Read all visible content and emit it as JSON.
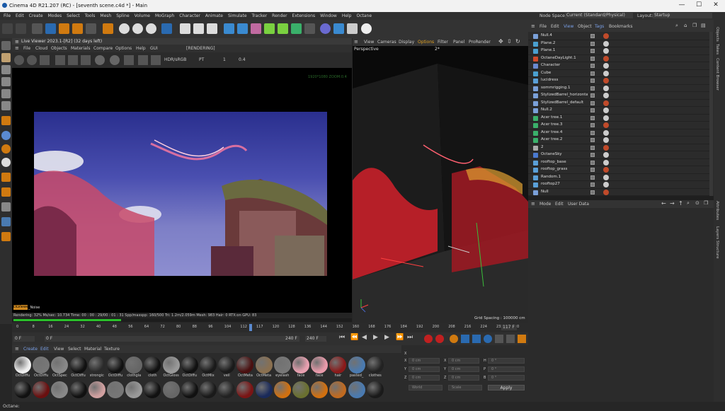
{
  "window": {
    "title": "Cinema 4D R21.207 (RC) - [seventh scene.c4d *] - Main",
    "min": "—",
    "max": "☐",
    "close": "✕"
  },
  "menubar": {
    "items": [
      "File",
      "Edit",
      "Create",
      "Modes",
      "Select",
      "Tools",
      "Mesh",
      "Spline",
      "Volume",
      "MoGraph",
      "Character",
      "Animate",
      "Simulate",
      "Tracker",
      "Render",
      "Extensions",
      "Window",
      "Help",
      "Octane"
    ],
    "node_space_label": "Node Space:",
    "node_space_value": "Current (Standard/Physical)",
    "layout_label": "Layout:",
    "layout_value": "Startup"
  },
  "live_viewer": {
    "title": "Live Viewer 2023.1-[R2] (32 days left)",
    "menu": [
      "File",
      "Cloud",
      "Objects",
      "Materials",
      "Compare",
      "Options",
      "Help",
      "GUI"
    ],
    "rendering_tag": "[RENDERING]",
    "tonemap": "HDR/sRGB",
    "pt": "PT",
    "spp": "1",
    "zoom": "0.4",
    "corner_info": "1920*1080 ZOOM:0.4",
    "kernel_tag": "DLViewer",
    "kernel_mode": "_Noise",
    "status": "Rendering: 32%   Ms/sec: 10.734   Time: 00 : 00 : 29/00 : 01 : 31   Spp/maxspp: 160/500   Tri: 1.2m/2.059m   Mesh: 983   Hair: 0   RTX:on   GPU:    83",
    "progress": 0.32
  },
  "viewport": {
    "menu": [
      "View",
      "Cameras",
      "Display",
      "Options",
      "Filter",
      "Panel",
      "ProRender"
    ],
    "camera": "Perspective",
    "fps": "2*",
    "grid": "Grid Spacing : 100000 cm"
  },
  "object_manager": {
    "menu": [
      "File",
      "Edit",
      "View",
      "Object",
      "Tags",
      "Bookmarks"
    ],
    "objects": [
      {
        "name": "Null.4",
        "icon": "null",
        "color": "#7aa0d8"
      },
      {
        "name": "Plane.2",
        "icon": "plane",
        "color": "#4aa0d0"
      },
      {
        "name": "Plane.1",
        "icon": "plane",
        "color": "#4aa0d0"
      },
      {
        "name": "OctaneDayLight.1",
        "icon": "light",
        "color": "#d04a2a"
      },
      {
        "name": "Character",
        "icon": "character",
        "color": "#6a8ad0"
      },
      {
        "name": "Cube",
        "icon": "cube",
        "color": "#4aa0d0"
      },
      {
        "name": "lucidress",
        "icon": "mesh",
        "color": "#5aa0d8"
      },
      {
        "name": "sommrigging.1",
        "icon": "null",
        "color": "#7aa0d8"
      },
      {
        "name": "StylizedBarrel_horizontal",
        "icon": "null",
        "color": "#7aa0d8"
      },
      {
        "name": "StylizedBarrel_default",
        "icon": "null",
        "color": "#7aa0d8"
      },
      {
        "name": "Null.2",
        "icon": "null",
        "color": "#7aa0d8"
      },
      {
        "name": "Acer tree.1",
        "icon": "tree",
        "color": "#3ab06a"
      },
      {
        "name": "Acer tree.3",
        "icon": "tree",
        "color": "#3ab06a"
      },
      {
        "name": "Acer tree.4",
        "icon": "tree",
        "color": "#3ab06a"
      },
      {
        "name": "Acer tree.2",
        "icon": "tree",
        "color": "#3ab06a"
      },
      {
        "name": "2",
        "icon": "null",
        "color": "#aaaaaa"
      },
      {
        "name": "OctaneSky",
        "icon": "sky",
        "color": "#4a7ad0"
      },
      {
        "name": "rooftop_base",
        "icon": "mesh",
        "color": "#5aa0d8"
      },
      {
        "name": "rooftop_grass",
        "icon": "mesh",
        "color": "#5aa0d8"
      },
      {
        "name": "Random.1",
        "icon": "mograph",
        "color": "#5aa0d8"
      },
      {
        "name": "rooftop27",
        "icon": "mesh",
        "color": "#5aa0d8"
      },
      {
        "name": "Null",
        "icon": "null",
        "color": "#7aa0d8"
      }
    ]
  },
  "attributes": {
    "menu": [
      "Mode",
      "Edit",
      "User Data"
    ]
  },
  "right_tabs": [
    "Objects",
    "Takes",
    "Content Browser",
    "Attributes",
    "Layers",
    "Structure"
  ],
  "timeline": {
    "ticks": [
      "0",
      "8",
      "16",
      "24",
      "32",
      "40",
      "48",
      "56",
      "64",
      "72",
      "80",
      "88",
      "96",
      "104",
      "112",
      "117",
      "120",
      "128",
      "136",
      "144",
      "152",
      "160",
      "168",
      "176",
      "184",
      "192",
      "200",
      "208",
      "216",
      "224",
      "232",
      "240"
    ],
    "current": "117 F"
  },
  "transport": {
    "start": "0 F",
    "current": "0 F",
    "end": "240 F",
    "end2": "240 F"
  },
  "materials": {
    "menu": [
      "Create",
      "Edit",
      "View",
      "Select",
      "Material",
      "Texture"
    ],
    "row1": [
      {
        "label": "OctDiffu",
        "color": "#f0f0f0"
      },
      {
        "label": "OctDiffu",
        "color": "#777"
      },
      {
        "label": "OctSpec",
        "color": "#888"
      },
      {
        "label": "OctDiffu",
        "color": "#111"
      },
      {
        "label": "strongic",
        "color": "#2a2a2a"
      },
      {
        "label": "OctDiffu",
        "color": "#111"
      },
      {
        "label": "clothgla",
        "color": "#666"
      },
      {
        "label": "cloth",
        "color": "#111"
      },
      {
        "label": "OctGloss",
        "color": "#999"
      },
      {
        "label": "OctDiffu",
        "color": "#111"
      },
      {
        "label": "OctMix",
        "color": "#1a1a1a"
      },
      {
        "label": "veil",
        "color": "#1a1a1a"
      },
      {
        "label": "OctMeta",
        "color": "#4a1010"
      },
      {
        "label": "OctMeta",
        "color": "#8a7050"
      },
      {
        "label": "eyelash",
        "color": "#777"
      },
      {
        "label": "face",
        "color": "#e8a0b0"
      },
      {
        "label": "face",
        "color": "#e89aaa"
      },
      {
        "label": "hair",
        "color": "#8a1a1a"
      },
      {
        "label": "pasted_",
        "color": "#4a7ab0"
      },
      {
        "label": "clothes",
        "color": "#222"
      }
    ],
    "row2": [
      {
        "color": "#111"
      },
      {
        "color": "#6a1010"
      },
      {
        "color": "#888"
      },
      {
        "color": "#111"
      },
      {
        "color": "#d0a0a0"
      },
      {
        "color": "#777"
      },
      {
        "color": "#999"
      },
      {
        "color": "#111"
      },
      {
        "color": "#666"
      },
      {
        "color": "#111"
      },
      {
        "color": "#1a1a1a"
      },
      {
        "color": "#222"
      },
      {
        "color": "#7a1515"
      },
      {
        "color": "#1a2a5a"
      },
      {
        "color": "#d07010"
      },
      {
        "color": "#6a7030"
      },
      {
        "color": "#d07010"
      },
      {
        "color": "#c06a20"
      },
      {
        "color": "#4a7ab0"
      },
      {
        "color": "#1a1a1a"
      }
    ]
  },
  "coords": {
    "x_label": "X",
    "y_label": "Y",
    "z_label": "Z",
    "h_label": "H",
    "p_label": "P",
    "b_label": "B",
    "zero_cm": "0 cm",
    "zero_deg": "0 °",
    "world": "World",
    "scale": "Scale",
    "apply": "Apply"
  },
  "statusbar": {
    "text": "Octane:"
  }
}
